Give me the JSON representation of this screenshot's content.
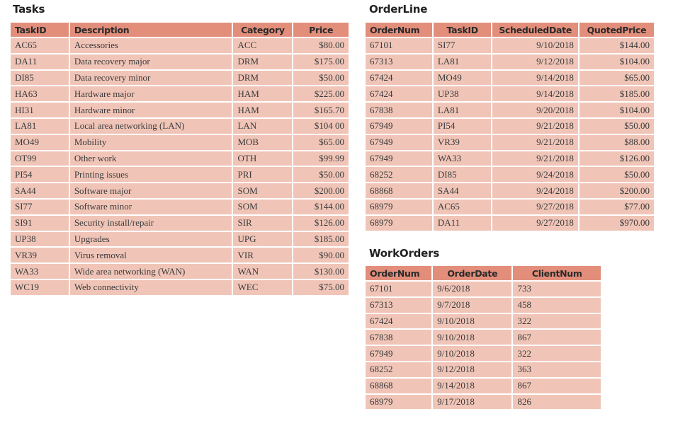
{
  "tasks": {
    "title": "Tasks",
    "columns": [
      "TaskID",
      "Description",
      "Category",
      "Price"
    ],
    "rows": [
      [
        "AC65",
        "Accessories",
        "ACC",
        "$80.00"
      ],
      [
        "DA11",
        "Data recovery major",
        "DRM",
        "$175.00"
      ],
      [
        "DI85",
        "Data recovery minor",
        "DRM",
        "$50.00"
      ],
      [
        "HA63",
        "Hardware major",
        "HAM",
        "$225.00"
      ],
      [
        "HI31",
        "Hardware minor",
        "HAM",
        "$165.70"
      ],
      [
        "LA81",
        "Local area networking (LAN)",
        "LAN",
        "$104 00"
      ],
      [
        "MO49",
        "Mobility",
        "MOB",
        "$65.00"
      ],
      [
        "OT99",
        "Other work",
        "OTH",
        "$99.99"
      ],
      [
        "PI54",
        "Printing issues",
        "PRI",
        "$50.00"
      ],
      [
        "SA44",
        "Software major",
        "SOM",
        "$200.00"
      ],
      [
        "SI77",
        "Software minor",
        "SOM",
        "$144.00"
      ],
      [
        "SI91",
        "Security install/repair",
        "SIR",
        "$126.00"
      ],
      [
        "UP38",
        "Upgrades",
        "UPG",
        "$185.00"
      ],
      [
        "VR39",
        "Virus removal",
        "VIR",
        "$90.00"
      ],
      [
        "WA33",
        "Wide area networking (WAN)",
        "WAN",
        "$130.00"
      ],
      [
        "WC19",
        "Web connectivity",
        "WEC",
        "$75.00"
      ]
    ]
  },
  "orderline": {
    "title": "OrderLine",
    "columns": [
      "OrderNum",
      "TaskID",
      "ScheduledDate",
      "QuotedPrice"
    ],
    "rows": [
      [
        "67101",
        "SI77",
        "9/10/2018",
        "$144.00"
      ],
      [
        "67313",
        "LA81",
        "9/12/2018",
        "$104.00"
      ],
      [
        "67424",
        "MO49",
        "9/14/2018",
        "$65.00"
      ],
      [
        "67424",
        "UP38",
        "9/14/2018",
        "$185.00"
      ],
      [
        "67838",
        "LA81",
        "9/20/2018",
        "$104.00"
      ],
      [
        "67949",
        "PI54",
        "9/21/2018",
        "$50.00"
      ],
      [
        "67949",
        "VR39",
        "9/21/2018",
        "$88.00"
      ],
      [
        "67949",
        "WA33",
        "9/21/2018",
        "$126.00"
      ],
      [
        "68252",
        "DI85",
        "9/24/2018",
        "$50.00"
      ],
      [
        "68868",
        "SA44",
        "9/24/2018",
        "$200.00"
      ],
      [
        "68979",
        "AC65",
        "9/27/2018",
        "$77.00"
      ],
      [
        "68979",
        "DA11",
        "9/27/2018",
        "$970.00"
      ]
    ]
  },
  "workorders": {
    "title": "WorkOrders",
    "columns": [
      "OrderNum",
      "OrderDate",
      "ClientNum"
    ],
    "rows": [
      [
        "67101",
        "9/6/2018",
        "733"
      ],
      [
        "67313",
        "9/7/2018",
        "458"
      ],
      [
        "67424",
        "9/10/2018",
        "322"
      ],
      [
        "67838",
        "9/10/2018",
        "867"
      ],
      [
        "67949",
        "9/10/2018",
        "322"
      ],
      [
        "68252",
        "9/12/2018",
        "363"
      ],
      [
        "68868",
        "9/14/2018",
        "867"
      ],
      [
        "68979",
        "9/17/2018",
        "826"
      ]
    ]
  },
  "colors": {
    "header_bg": "#e28e7b",
    "cell_bg": "#f0c5b8",
    "title_text": "#222222",
    "cell_text": "#3a3a3a"
  }
}
